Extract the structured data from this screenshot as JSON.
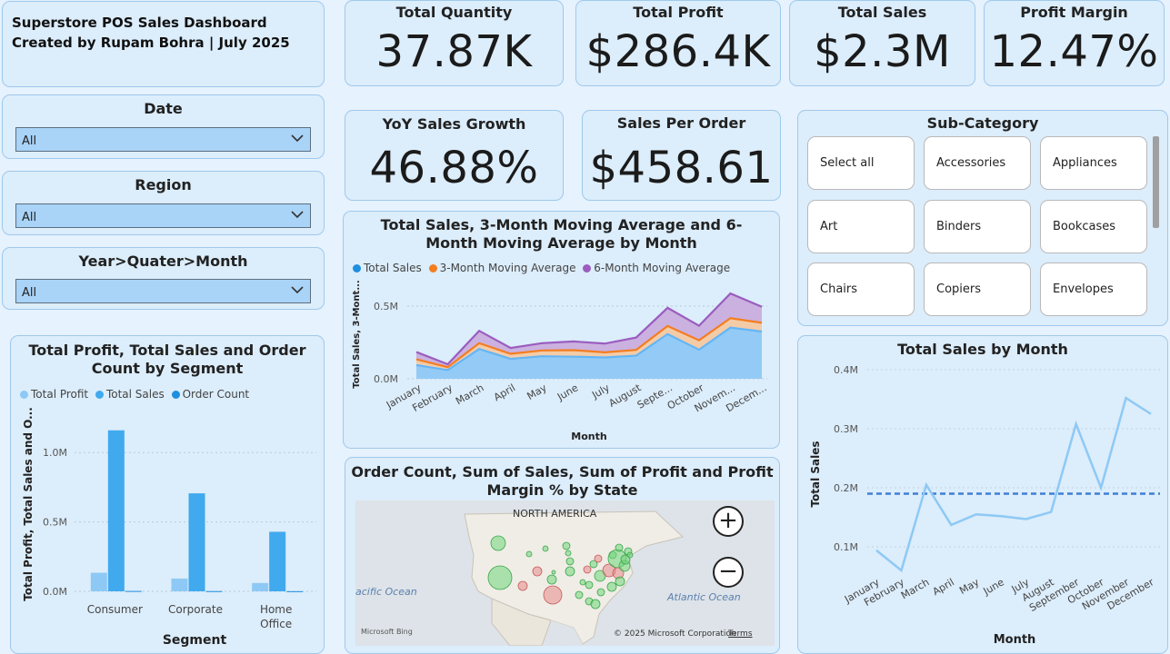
{
  "header": {
    "title": "Superstore POS Sales Dashboard",
    "subtitle": "Created by Rupam Bohra | July 2025"
  },
  "kpis": {
    "total_quantity": {
      "label": "Total Quantity",
      "value": "37.87K"
    },
    "total_profit": {
      "label": "Total Profit",
      "value": "$286.4K"
    },
    "total_sales": {
      "label": "Total Sales",
      "value": "$2.3M"
    },
    "profit_margin": {
      "label": "Profit Margin",
      "value": "12.47%"
    },
    "yoy_growth": {
      "label": "YoY Sales Growth",
      "value": "46.88%"
    },
    "sales_per_order": {
      "label": "Sales Per Order",
      "value": "$458.61"
    }
  },
  "slicers": {
    "date": {
      "title": "Date",
      "value": "All",
      "icon": "chevron-down-icon"
    },
    "region": {
      "title": "Region",
      "value": "All",
      "icon": "chevron-down-icon"
    },
    "period": {
      "title": "Year>Quater>Month",
      "value": "All",
      "icon": "chevron-down-icon"
    }
  },
  "subcategory": {
    "title": "Sub-Category",
    "items": [
      "Select all",
      "Accessories",
      "Appliances",
      "Art",
      "Binders",
      "Bookcases",
      "Chairs",
      "Copiers",
      "Envelopes"
    ]
  },
  "map": {
    "title": "Order Count, Sum of Sales, Sum of Profit and Profit Margin % by State",
    "region_label": "NORTH AMERICA",
    "pacific": "acific Ocean",
    "atlantic": "Atlantic Ocean",
    "copyright": "© 2025 Microsoft Corporation",
    "terms": "Terms",
    "bing": "Microsoft Bing",
    "zoom_in": "+",
    "zoom_out": "−"
  },
  "colors": {
    "card_bg": "#dcedfb",
    "card_border": "#9fc9ec",
    "light_blue": "#8ec9f5",
    "mid_blue": "#41a9ee",
    "dark_blue": "#1f8fe0",
    "orange": "#f47d20",
    "purple": "#9a5dbf",
    "map_green": "#6fd67a",
    "map_red": "#e88a8a"
  },
  "chart_data": [
    {
      "id": "segment",
      "type": "bar",
      "title": "Total Profit, Total Sales and Order Count by Segment",
      "xlabel": "Segment",
      "ylabel": "Total Profit, Total Sales and O...",
      "categories": [
        "Consumer",
        "Corporate",
        "Home Office"
      ],
      "series": [
        {
          "name": "Total Profit",
          "values": [
            134000,
            92000,
            60000
          ],
          "color": "#8ec9f5"
        },
        {
          "name": "Total Sales",
          "values": [
            1160000,
            706000,
            429000
          ],
          "color": "#41a9ee"
        },
        {
          "name": "Order Count",
          "values": [
            2586,
            1514,
            910
          ],
          "color": "#1f8fe0"
        }
      ],
      "yticks": [
        "0.0M",
        "0.5M",
        "1.0M"
      ],
      "ylim": [
        0,
        1250000
      ],
      "grid": true,
      "legend": "top-left"
    },
    {
      "id": "moving_avg",
      "type": "area",
      "title": "Total Sales, 3-Month Moving Average and 6-Month Moving Average by Month",
      "xlabel": "Month",
      "ylabel": "Total Sales, 3-Mont...",
      "categories": [
        "January",
        "February",
        "March",
        "April",
        "May",
        "June",
        "July",
        "August",
        "Septe...",
        "October",
        "Novem...",
        "Decem..."
      ],
      "series": [
        {
          "name": "Total Sales",
          "values": [
            94000,
            60000,
            205000,
            137000,
            155000,
            152000,
            147000,
            159000,
            308000,
            200000,
            352000,
            325000
          ],
          "color": "#64b5f6"
        },
        {
          "name": "3-Month Moving Average",
          "values": [
            40000,
            20000,
            40000,
            35000,
            40000,
            45000,
            35000,
            40000,
            55000,
            65000,
            65000,
            60000
          ],
          "color": "#f47d20"
        },
        {
          "name": "6-Month Moving Average",
          "values": [
            50000,
            20000,
            85000,
            40000,
            50000,
            60000,
            60000,
            85000,
            125000,
            100000,
            170000,
            110000
          ],
          "color": "#9a5dbf"
        }
      ],
      "yticks": [
        "0.0M",
        "0.5M"
      ],
      "ylim": [
        0,
        650000
      ],
      "grid": true,
      "legend": "top"
    },
    {
      "id": "monthly",
      "type": "line",
      "title": "Total Sales by Month",
      "xlabel": "Month",
      "ylabel": "Total Sales",
      "categories": [
        "January",
        "February",
        "March",
        "April",
        "May",
        "June",
        "July",
        "August",
        "September",
        "October",
        "November",
        "December"
      ],
      "series": [
        {
          "name": "Total Sales",
          "values": [
            94000,
            60000,
            205000,
            137000,
            155000,
            152000,
            147000,
            159000,
            308000,
            200000,
            352000,
            325000
          ],
          "color": "#8ec9f5"
        }
      ],
      "average_line": 190000,
      "yticks": [
        "0.1M",
        "0.2M",
        "0.3M",
        "0.4M"
      ],
      "ylim": [
        60000,
        420000
      ],
      "grid": true
    }
  ]
}
